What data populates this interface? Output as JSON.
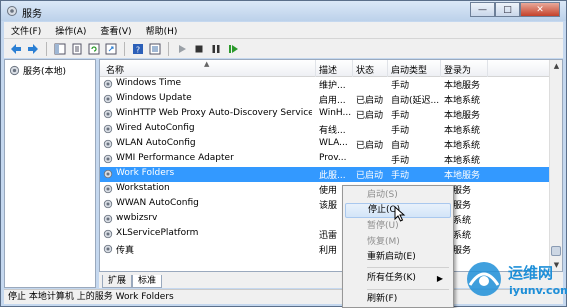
{
  "window": {
    "title": "服务",
    "min_glyph": "—",
    "max_glyph": "□",
    "close_glyph": "✕"
  },
  "menu": [
    "文件(F)",
    "操作(A)",
    "查看(V)",
    "帮助(H)"
  ],
  "toolbar_icons": [
    "back-icon",
    "forward-icon",
    "console-tree-icon",
    "properties-icon",
    "refresh-icon",
    "export-icon",
    "help-icon",
    "view-icon",
    "start-icon",
    "stop-icon",
    "pause-icon",
    "restart-icon"
  ],
  "tree": {
    "root_label": "服务(本地)"
  },
  "columns": {
    "name": "名称",
    "desc": "描述",
    "status": "状态",
    "startup": "启动类型",
    "logon": "登录为"
  },
  "services": [
    {
      "name": "Windows Time",
      "desc": "维护...",
      "status": "",
      "startup": "手动",
      "logon": "本地服务"
    },
    {
      "name": "Windows Update",
      "desc": "启用...",
      "status": "已启动",
      "startup": "自动(延迟...",
      "logon": "本地系统"
    },
    {
      "name": "WinHTTP Web Proxy Auto-Discovery Service",
      "desc": "WinH...",
      "status": "已启动",
      "startup": "手动",
      "logon": "本地服务"
    },
    {
      "name": "Wired AutoConfig",
      "desc": "有线...",
      "status": "",
      "startup": "手动",
      "logon": "本地系统"
    },
    {
      "name": "WLAN AutoConfig",
      "desc": "WLA...",
      "status": "已启动",
      "startup": "自动",
      "logon": "本地系统"
    },
    {
      "name": "WMI Performance Adapter",
      "desc": "Prov...",
      "status": "",
      "startup": "手动",
      "logon": "本地系统"
    },
    {
      "name": "Work Folders",
      "desc": "此服...",
      "status": "已启动",
      "startup": "手动",
      "logon": "本地服务"
    },
    {
      "name": "Workstation",
      "desc": "使用",
      "status": "",
      "startup": "",
      "logon": "络服务"
    },
    {
      "name": "WWAN AutoConfig",
      "desc": "该服",
      "status": "",
      "startup": "",
      "logon": "地服务"
    },
    {
      "name": "wwbizsrv",
      "desc": "",
      "status": "",
      "startup": "",
      "logon": "地系统"
    },
    {
      "name": "XLServicePlatform",
      "desc": "迅雷",
      "status": "",
      "startup": "",
      "logon": "地系统"
    },
    {
      "name": "传真",
      "desc": "利用",
      "status": "",
      "startup": "",
      "logon": "络服务"
    }
  ],
  "selected_row": "Work Folders",
  "tabs": [
    "扩展",
    "标准"
  ],
  "status_text": "停止 本地计算机 上的服务 Work Folders",
  "context_menu": {
    "start": "启动(S)",
    "stop": "停止(O)",
    "pause": "暂停(U)",
    "resume": "恢复(M)",
    "restart": "重新启动(E)",
    "all_tasks": "所有任务(K)",
    "refresh": "刷新(F)",
    "submenu_arrow": "▶"
  },
  "watermark": {
    "cn": "运维网",
    "en": "iyunv.com"
  },
  "colors": {
    "selection": "#3399ff",
    "window_frame": "#c5d8ef",
    "accent": "#1e8fd8"
  }
}
